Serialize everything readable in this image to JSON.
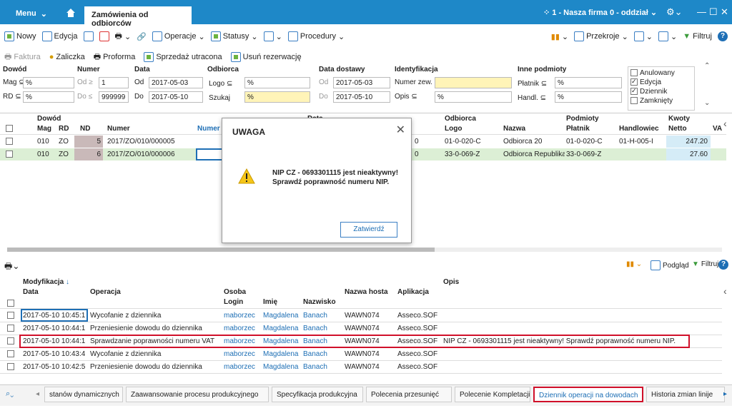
{
  "window": {
    "menu_label": "Menu",
    "tab_title": "Zamówienia od odbiorców",
    "firm_label": "1 - Nasza firma 0 - oddział"
  },
  "toolbar": {
    "new": "Nowy",
    "edit": "Edycja",
    "operations": "Operacje",
    "statuses": "Statusy",
    "procedures": "Procedury",
    "reports": "Przekroje",
    "filter": "Filtruj"
  },
  "toolbar2": {
    "invoice": "Faktura",
    "advance": "Zaliczka",
    "proforma": "Proforma",
    "lost_sale": "Sprzedaż utracona",
    "remove_reservation": "Usuń rezerwację"
  },
  "filters": {
    "dowod_label": "Dowód",
    "mag_label": "Mag",
    "mag_value": "%",
    "rd_label": "RD",
    "rd_value": "%",
    "numer_label": "Numer",
    "od_label": "Od",
    "od_value": "1",
    "do_label": "Do",
    "do_value": "999999",
    "data_label": "Data",
    "data_od": "2017-05-03",
    "data_do": "2017-05-10",
    "odbiorca_label": "Odbiorca",
    "logo_label": "Logo",
    "logo_value": "%",
    "szukaj_label": "Szukaj",
    "szukaj_value": "%",
    "data_dostawy_label": "Data dostawy",
    "dd_od": "2017-05-03",
    "dd_do": "2017-05-10",
    "ident_label": "Identyfikacja",
    "numer_zew_label": "Numer zew.",
    "opis_label": "Opis",
    "opis_value": "%",
    "inne_label": "Inne podmioty",
    "platnik_label": "Płatnik",
    "platnik_value": "%",
    "handl_label": "Handl.",
    "handl_value": "%",
    "chk_anulowany": "Anulowany",
    "chk_edycja": "Edycja",
    "chk_dziennik": "Dziennik",
    "chk_zamkniety": "Zamknięty"
  },
  "top_grid": {
    "headers": {
      "dowod": "Dowód",
      "mag": "Mag",
      "rd": "RD",
      "nd": "ND",
      "numer": "Numer",
      "numer2": "Numer",
      "data": "Data",
      "odbiorca": "Odbiorca",
      "logo": "Logo",
      "nazwa": "Nazwa",
      "podmioty": "Podmioty",
      "platnik": "Płatnik",
      "handlowiec": "Handlowiec",
      "kwoty": "Kwoty",
      "netto": "Netto",
      "va": "VA"
    },
    "rows": [
      {
        "mag": "010",
        "rd": "ZO",
        "nd": "5",
        "numer": "2017/ZO/010/000005",
        "frag": "0",
        "logo": "01-0-020-C",
        "nazwa": "Odbiorca 20",
        "platnik": "01-0-020-C",
        "handlowiec": "01-H-005-I",
        "netto": "247.20"
      },
      {
        "mag": "010",
        "rd": "ZO",
        "nd": "6",
        "numer": "2017/ZO/010/000006",
        "frag": "0",
        "logo": "33-0-069-Z",
        "nazwa": "Odbiorca Republika (",
        "platnik": "33-0-069-Z",
        "handlowiec": "",
        "netto": "27.60"
      }
    ]
  },
  "dialog": {
    "title": "UWAGA",
    "line1": "NIP CZ - 0693301115 jest nieaktywny!",
    "line2": "Sprawdź poprawność numeru NIP.",
    "confirm": "Zatwierdź"
  },
  "mid": {
    "preview": "Podgląd",
    "filter": "Filtruj"
  },
  "bottom_grid": {
    "headers": {
      "modyfikacja": "Modyfikacja",
      "data": "Data",
      "operacja": "Operacja",
      "osoba": "Osoba",
      "login": "Login",
      "imie": "Imię",
      "nazwisko": "Nazwisko",
      "host": "Nazwa hosta",
      "app": "Aplikacja",
      "opis": "Opis"
    },
    "rows": [
      {
        "data": "2017-05-10 10:45:1",
        "op": "Wycofanie z dziennika",
        "login": "maborzec",
        "imie": "Magdalena",
        "nazwisko": "Banach",
        "host": "WAWN074",
        "app": "Asseco.SOF",
        "opis": ""
      },
      {
        "data": "2017-05-10 10:44:1",
        "op": "Przeniesienie dowodu do dziennika",
        "login": "maborzec",
        "imie": "Magdalena",
        "nazwisko": "Banach",
        "host": "WAWN074",
        "app": "Asseco.SOF",
        "opis": ""
      },
      {
        "data": "2017-05-10 10:44:1",
        "op": "Sprawdzanie poprawności numeru VAT",
        "login": "maborzec",
        "imie": "Magdalena",
        "nazwisko": "Banach",
        "host": "WAWN074",
        "app": "Asseco.SOF",
        "opis": "NIP CZ - 0693301115 jest nieaktywny!  Sprawdź poprawność numeru NIP."
      },
      {
        "data": "2017-05-10 10:43:4",
        "op": "Wycofanie z dziennika",
        "login": "maborzec",
        "imie": "Magdalena",
        "nazwisko": "Banach",
        "host": "WAWN074",
        "app": "Asseco.SOF",
        "opis": ""
      },
      {
        "data": "2017-05-10 10:42:5",
        "op": "Przeniesienie dowodu do dziennika",
        "login": "maborzec",
        "imie": "Magdalena",
        "nazwisko": "Banach",
        "host": "WAWN074",
        "app": "Asseco.SOF",
        "opis": ""
      }
    ]
  },
  "tabs": [
    "stanów dynamicznych",
    "Zaawansowanie procesu produkcyjnego",
    "Specyfikacja produkcyjna",
    "Polecenia przesunięć",
    "Polecenie Kompletacji",
    "Dziennik operacji na dowodach",
    "Historia zmian linije"
  ]
}
